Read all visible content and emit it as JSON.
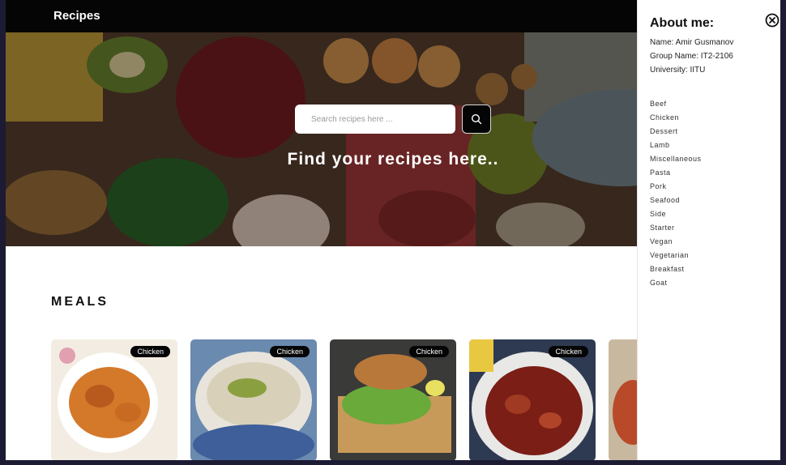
{
  "navbar": {
    "brand": "Recipes"
  },
  "hero": {
    "search_placeholder": "Search recipes here ...",
    "title": "Find your recipes here.."
  },
  "meals": {
    "title": "MEALS",
    "cards": [
      {
        "badge": "Chicken"
      },
      {
        "badge": "Chicken"
      },
      {
        "badge": "Chicken"
      },
      {
        "badge": "Chicken"
      }
    ]
  },
  "sidebar": {
    "title": "About me:",
    "name": "Name: Amir Gusmanov",
    "group": "Group Name: IT2-2106",
    "university": "University: IITU",
    "categories": [
      "Beef",
      "Chicken",
      "Dessert",
      "Lamb",
      "Miscellaneous",
      "Pasta",
      "Pork",
      "Seafood",
      "Side",
      "Starter",
      "Vegan",
      "Vegetarian",
      "Breakfast",
      "Goat"
    ]
  },
  "icons": {
    "search": "search-icon",
    "close": "close-circle-icon"
  },
  "colors": {
    "navbar": "#050505",
    "badge": "#050505",
    "frame_border": "#1c1b33"
  }
}
